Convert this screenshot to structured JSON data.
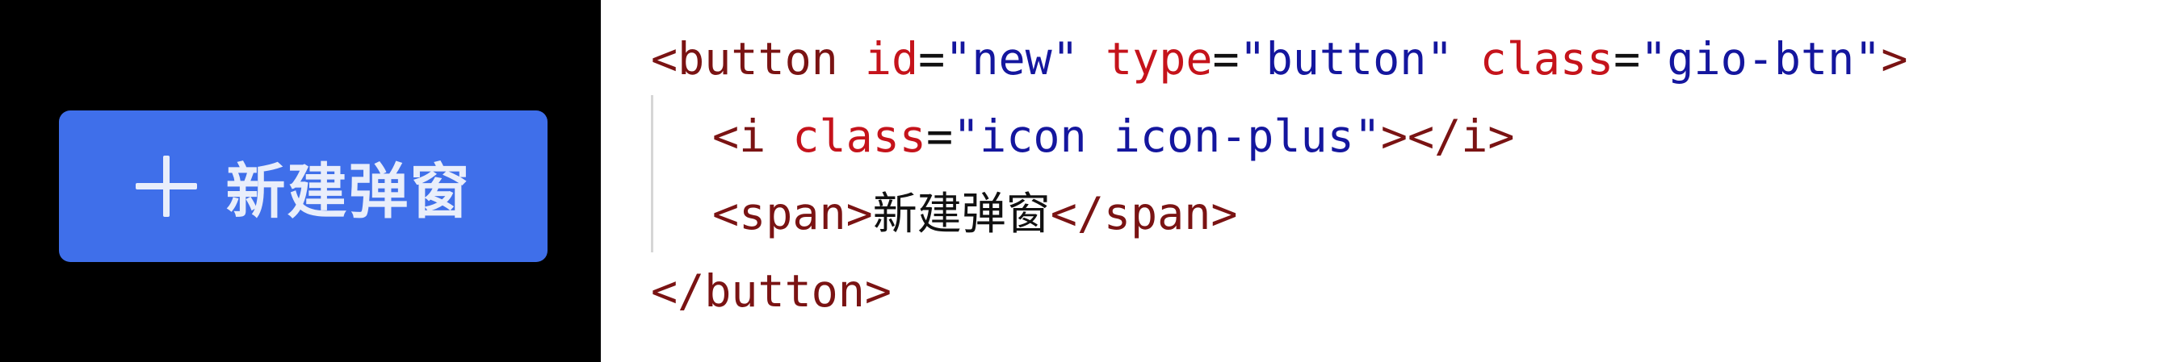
{
  "preview": {
    "button": {
      "icon": "plus-icon",
      "label": "新建弹窗",
      "bg_color": "#3F6FEA",
      "text_color": "#E9EEFB"
    }
  },
  "code": {
    "line1": {
      "open": "<button",
      "attr1_name": "id",
      "attr1_value": "\"new\"",
      "attr2_name": "type",
      "attr2_value": "\"button\"",
      "attr3_name": "class",
      "attr3_value": "\"gio-btn\"",
      "close": ">"
    },
    "line2": {
      "open": "<i",
      "attr_name": "class",
      "attr_value": "\"icon icon-plus\"",
      "close": "></i>"
    },
    "line3": {
      "open": "<span>",
      "text": "新建弹窗",
      "close": "</span>"
    },
    "line4": {
      "close": "</button>"
    },
    "colors": {
      "tag": "#7A1313",
      "attribute": "#C5131B",
      "string": "#14169E"
    }
  }
}
